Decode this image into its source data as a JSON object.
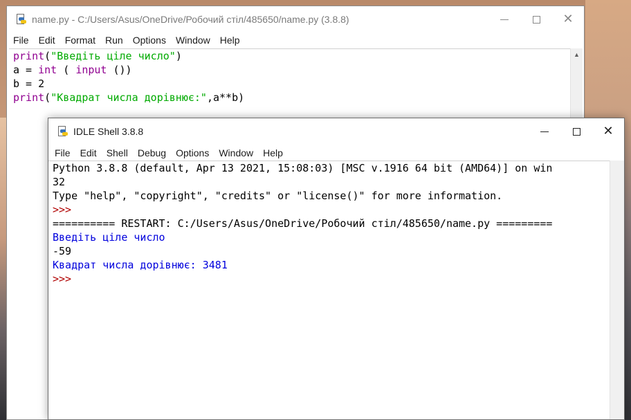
{
  "editor": {
    "title": "name.py - C:/Users/Asus/OneDrive/Робочий стіл/485650/name.py (3.8.8)",
    "menu": [
      "File",
      "Edit",
      "Format",
      "Run",
      "Options",
      "Window",
      "Help"
    ],
    "code": [
      [
        {
          "t": "print",
          "c": "kw"
        },
        {
          "t": "(",
          "c": "plain"
        },
        {
          "t": "\"Введіть ціле число\"",
          "c": "str"
        },
        {
          "t": ")",
          "c": "plain"
        }
      ],
      [
        {
          "t": "a = ",
          "c": "plain"
        },
        {
          "t": "int",
          "c": "kw"
        },
        {
          "t": " ( ",
          "c": "plain"
        },
        {
          "t": "input",
          "c": "kw"
        },
        {
          "t": " ())",
          "c": "plain"
        }
      ],
      [
        {
          "t": "b = 2",
          "c": "plain"
        }
      ],
      [
        {
          "t": "print",
          "c": "kw"
        },
        {
          "t": "(",
          "c": "plain"
        },
        {
          "t": "\"Квадрат числа дорівнює:\"",
          "c": "str"
        },
        {
          "t": ",a**b)",
          "c": "plain"
        }
      ]
    ]
  },
  "shell": {
    "title": "IDLE Shell 3.8.8",
    "menu": [
      "File",
      "Edit",
      "Shell",
      "Debug",
      "Options",
      "Window",
      "Help"
    ],
    "lines": [
      {
        "t": "Python 3.8.8 (default, Apr 13 2021, 15:08:03) [MSC v.1916 64 bit (AMD64)] on win",
        "c": "out"
      },
      {
        "t": "32",
        "c": "out"
      },
      {
        "t": "Type \"help\", \"copyright\", \"credits\" or \"license()\" for more information.",
        "c": "out"
      },
      {
        "t": ">>> ",
        "c": "prompt"
      },
      {
        "t": "========== RESTART: C:/Users/Asus/OneDrive/Робочий стіл/485650/name.py =========",
        "c": "out"
      },
      {
        "t": "Введіть ціле число",
        "c": "stdout"
      },
      {
        "t": "-59",
        "c": "stdin"
      },
      {
        "t": "Квадрат числа дорівнює: 3481",
        "c": "stdout"
      },
      {
        "t": ">>> ",
        "c": "prompt"
      }
    ]
  },
  "icons": {
    "minimize": "minimize-icon",
    "maximize": "maximize-icon",
    "close": "close-icon",
    "file": "python-file-icon"
  }
}
